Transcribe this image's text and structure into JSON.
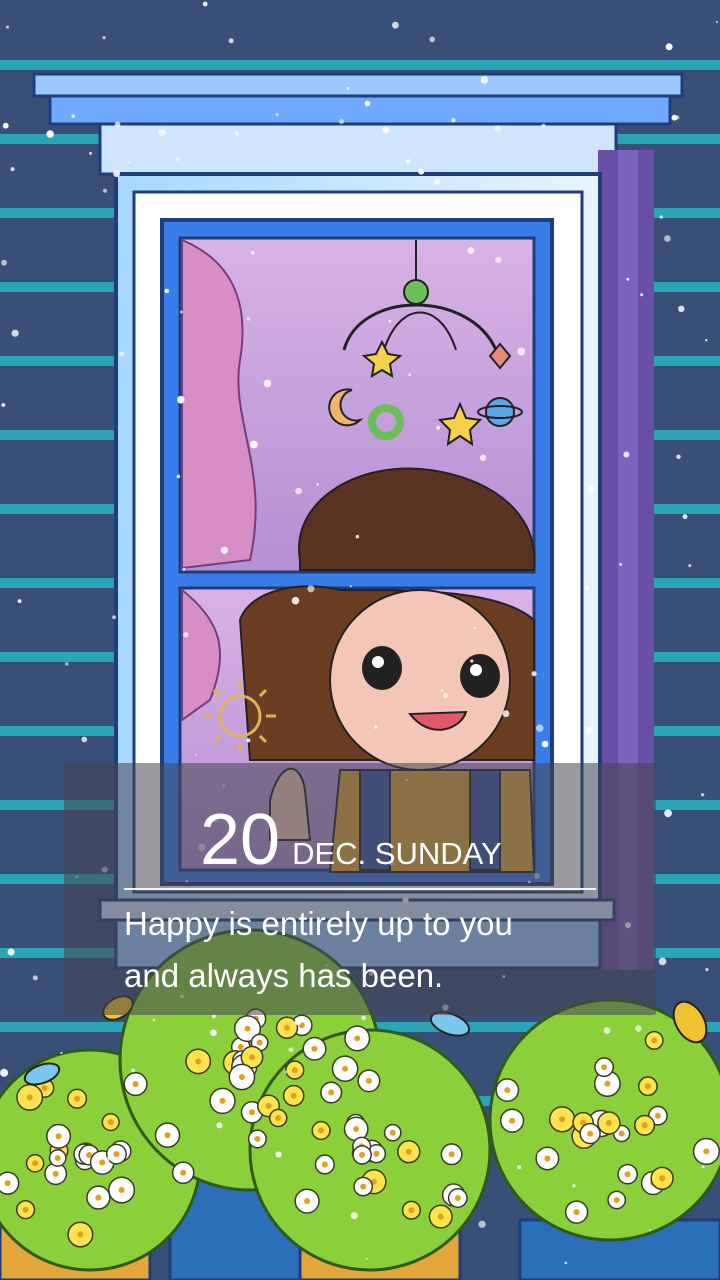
{
  "lockscreen": {
    "day": "20",
    "month_weekday": "DEC. SUNDAY",
    "quote_line1": "Happy is entirely up to you",
    "quote_line2": "and always has been."
  },
  "wallpaper": {
    "description_icons": [
      "window-icon",
      "mobile-toy-icon",
      "girl-illustration",
      "sun-drawing-icon",
      "flower-pot-icon",
      "butterfly-icon",
      "snowflake-icon"
    ],
    "colors": {
      "wall": "#3a4f78",
      "siding_stripe": "#2aa5b5",
      "window_frame": "#7fc3ff",
      "window_glass": "#c59bd6",
      "curtain": "#d68fc3",
      "flowers_yellow": "#ffe34d",
      "flowers_white": "#ffffff",
      "leaves": "#8bcf3a",
      "overlay": "rgba(70,70,80,0.55)"
    }
  }
}
